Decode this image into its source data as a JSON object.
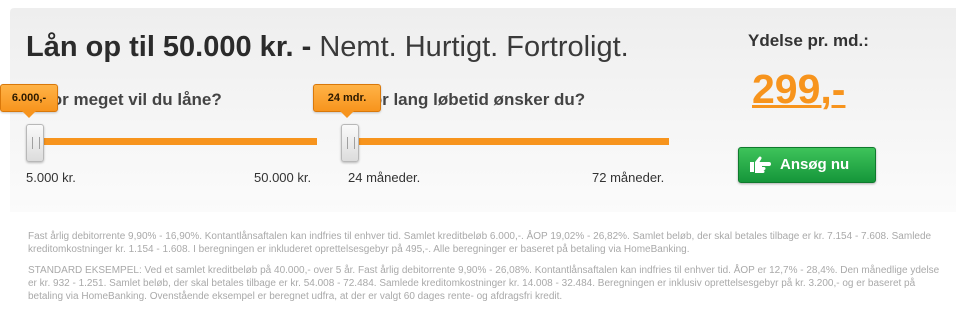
{
  "headline": {
    "bold": "Lån op til 50.000 kr. -",
    "light": "Nemt. Hurtigt. Fortroligt."
  },
  "amount_slider": {
    "question": "Hvor meget vil du låne?",
    "bubble": "6.000,-",
    "min_label": "5.000 kr.",
    "max_label": "50.000 kr."
  },
  "term_slider": {
    "question": "Hvor lang løbetid ønsker du?",
    "bubble": "24 mdr.",
    "min_label": "24 måneder.",
    "max_label": "72 måneder."
  },
  "payment": {
    "label": "Ydelse pr. md.:",
    "value": "299,-"
  },
  "apply_button": {
    "label": "Ansøg nu",
    "icon": "pointing-hand-icon"
  },
  "fine_print": {
    "paragraph1": "Fast årlig debitorrente 9,90% - 16,90%. Kontantlånsaftalen kan indfries til enhver tid. Samlet kreditbeløb 6.000,-. ÅOP 19,02% - 26,82%. Samlet beløb, der skal betales tilbage er kr. 7.154 - 7.608. Samlede kreditomkostninger kr. 1.154 - 1.608. I beregningen er inkluderet oprettelsesgebyr på 495,-. Alle beregninger er baseret på betaling via HomeBanking.",
    "paragraph2": "STANDARD EKSEMPEL: Ved et samlet kreditbeløb på 40.000,- over 5 år. Fast årlig debitorrente 9,90% - 26,08%. Kontantlånsaftalen kan indfries til enhver tid. ÅOP er 12,7% - 28,4%. Den månedlige ydelse er kr. 932 - 1.251. Samlet beløb, der skal betales tilbage er kr. 54.008 - 72.484. Samlede kreditomkostninger kr. 14.008 - 32.484. Beregningen er inklusiv oprettelsesgebyr på kr. 3.200,- og er baseret på betaling via HomeBanking. Ovenstående eksempel er beregnet udfra, at der er valgt 60 dages rente- og afdragsfri kredit."
  },
  "colors": {
    "accent": "#f7941d",
    "button": "#1fa544",
    "fine_print": "#a9a9a9"
  }
}
